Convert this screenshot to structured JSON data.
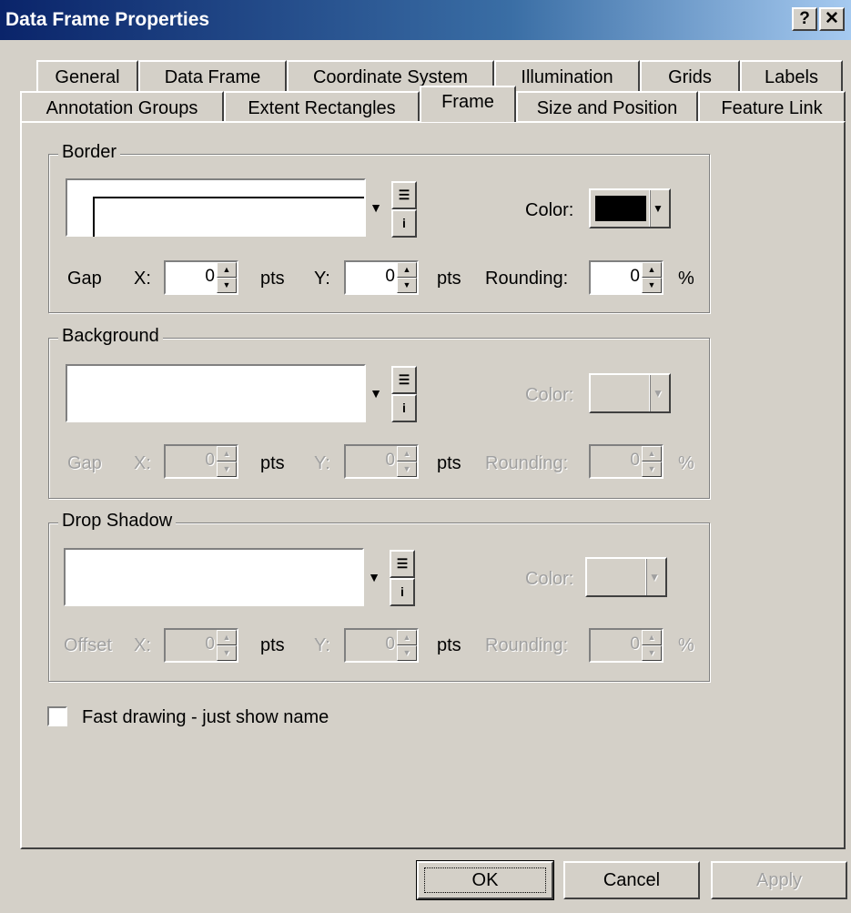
{
  "window": {
    "title": "Data Frame Properties",
    "help_label": "?",
    "close_label": "✕"
  },
  "tabs_row1": [
    "General",
    "Data Frame",
    "Coordinate System",
    "Illumination",
    "Grids",
    "Labels"
  ],
  "tabs_row2": [
    "Annotation Groups",
    "Extent Rectangles",
    "Frame",
    "Size and Position",
    "Feature Link"
  ],
  "active_tab": "Frame",
  "border": {
    "label": "Border",
    "color_label": "Color:",
    "color_value": "#000000",
    "gap_label": "Gap",
    "x_label": "X:",
    "x_value": "0",
    "y_label": "Y:",
    "y_value": "0",
    "unit": "pts",
    "rounding_label": "Rounding:",
    "rounding_value": "0",
    "percent": "%"
  },
  "background": {
    "label": "Background",
    "color_label": "Color:",
    "gap_label": "Gap",
    "x_label": "X:",
    "x_value": "0",
    "y_label": "Y:",
    "y_value": "0",
    "unit": "pts",
    "rounding_label": "Rounding:",
    "rounding_value": "0",
    "percent": "%"
  },
  "drop_shadow": {
    "label": "Drop Shadow",
    "color_label": "Color:",
    "offset_label": "Offset",
    "x_label": "X:",
    "x_value": "0",
    "y_label": "Y:",
    "y_value": "0",
    "unit": "pts",
    "rounding_label": "Rounding:",
    "rounding_value": "0",
    "percent": "%"
  },
  "fast_drawing": {
    "label": "Fast drawing - just show name",
    "checked": false
  },
  "buttons": {
    "ok": "OK",
    "cancel": "Cancel",
    "apply": "Apply"
  },
  "icons": {
    "properties": "properties-icon",
    "info": "info-icon",
    "dropdown": "dropdown-arrow-icon"
  }
}
